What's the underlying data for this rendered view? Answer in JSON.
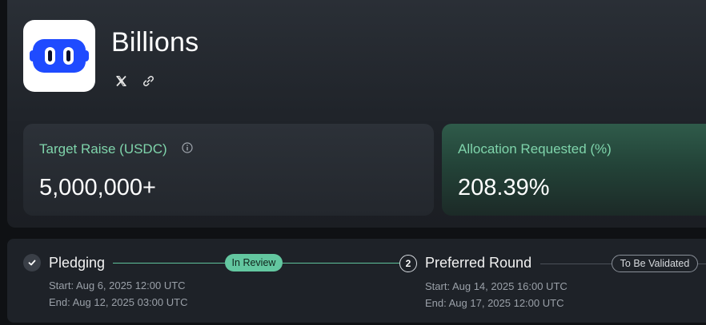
{
  "project": {
    "name": "Billions"
  },
  "icons": {
    "logo": "billions-logo",
    "social": [
      "x-icon",
      "link-icon"
    ],
    "info": "info-icon",
    "step_done": "check-icon"
  },
  "colors": {
    "accent_green": "#7fd4ab",
    "badge_review": "#63c7a0",
    "logo_blue": "#1f4bff"
  },
  "stats": {
    "target": {
      "label": "Target Raise (USDC)",
      "value": "5,000,000+"
    },
    "allocation": {
      "label": "Allocation Requested (%)",
      "value": "208.39%"
    }
  },
  "timeline": {
    "steps": [
      {
        "name": "Pledging",
        "status": "In Review",
        "start": "Start: Aug 6, 2025 12:00 UTC",
        "end": "End: Aug 12, 2025 03:00 UTC"
      },
      {
        "number": "2",
        "name": "Preferred Round",
        "status": "To Be Validated",
        "start": "Start: Aug 14, 2025 16:00 UTC",
        "end": "End: Aug 17, 2025 12:00 UTC"
      }
    ]
  }
}
